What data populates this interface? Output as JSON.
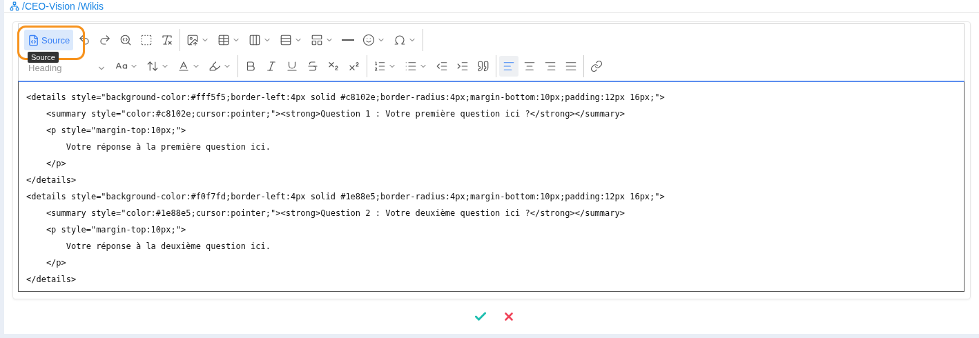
{
  "breadcrumb": [
    "/CEO-Vision",
    "/Wikis"
  ],
  "toolbar": {
    "rows": [
      [
        [
          {
            "kind": "source",
            "label": "Source",
            "selected": true
          },
          {
            "kind": "icon",
            "selected": false
          },
          {
            "kind": "icon",
            "selected": false
          },
          {
            "kind": "icon",
            "selected": false
          },
          {
            "kind": "icon",
            "selected": false
          },
          {
            "kind": "icon",
            "selected": false
          }
        ],
        [
          {
            "kind": "dropdown",
            "selected": false
          },
          {
            "kind": "dropdown",
            "selected": false
          },
          {
            "kind": "dropdown",
            "selected": false
          },
          {
            "kind": "dropdown",
            "selected": false
          },
          {
            "kind": "dropdown",
            "selected": false
          },
          {
            "kind": "icon",
            "selected": false
          },
          {
            "kind": "dropdown",
            "selected": false
          },
          {
            "kind": "dropdown",
            "selected": false
          }
        ]
      ],
      [
        [
          {
            "kind": "select",
            "label": "Heading"
          },
          {
            "kind": "dropdown",
            "selected": false
          },
          {
            "kind": "dropdown",
            "selected": false
          },
          {
            "kind": "dropdown",
            "selected": false
          },
          {
            "kind": "dropdown",
            "selected": false
          }
        ],
        [
          {
            "kind": "icon",
            "selected": false
          },
          {
            "kind": "icon",
            "selected": false
          },
          {
            "kind": "icon",
            "selected": false
          },
          {
            "kind": "icon",
            "selected": false
          },
          {
            "kind": "icon",
            "selected": false
          },
          {
            "kind": "icon",
            "selected": false
          }
        ],
        [
          {
            "kind": "dropdown",
            "selected": false
          },
          {
            "kind": "dropdown",
            "selected": false
          },
          {
            "kind": "icon",
            "selected": false
          },
          {
            "kind": "icon",
            "selected": false
          },
          {
            "kind": "icon",
            "selected": false
          }
        ],
        [
          {
            "kind": "icon",
            "selected": true
          },
          {
            "kind": "icon",
            "selected": false
          },
          {
            "kind": "icon",
            "selected": false
          },
          {
            "kind": "icon",
            "selected": false
          }
        ],
        [
          {
            "kind": "icon",
            "selected": false
          }
        ]
      ]
    ],
    "tooltip": "Source"
  },
  "source_lines": [
    "<details style=\"background-color:#fff5f5;border-left:4px solid #c8102e;border-radius:4px;margin-bottom:10px;padding:12px 16px;\">",
    "    <summary style=\"color:#c8102e;cursor:pointer;\"><strong>Question 1 : Votre première question ici ?</strong></summary>",
    "    <p style=\"margin-top:10px;\">",
    "        Votre réponse à la première question ici.",
    "    </p>",
    "</details>",
    "<details style=\"background-color:#f0f7fd;border-left:4px solid #1e88e5;border-radius:4px;margin-bottom:10px;padding:12px 16px;\">",
    "    <summary style=\"color:#1e88e5;cursor:pointer;\"><strong>Question 2 : Votre deuxième question ici ?</strong></summary>",
    "    <p style=\"margin-top:10px;\">",
    "        Votre réponse à la deuxième question ici.",
    "    </p>",
    "</details>"
  ],
  "actions": [
    {
      "kind": "confirm"
    },
    {
      "kind": "cancel"
    }
  ]
}
